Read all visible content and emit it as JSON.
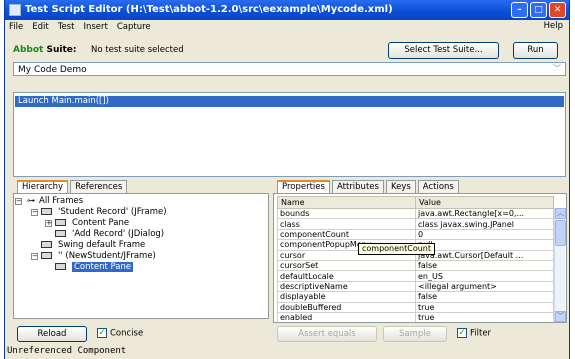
{
  "window": {
    "title": "Test Script Editor  (H:\\Test\\abbot-1.2.0\\src\\eexample\\Mycode.xml)",
    "minimize": "–",
    "maximize": "□",
    "close": "✕"
  },
  "menu": {
    "items": [
      "File",
      "Edit",
      "Test",
      "Insert",
      "Capture"
    ],
    "help": "Help"
  },
  "suite": {
    "label_abbot": "Abbot",
    "label_rest": " Suite:",
    "status": "No test suite selected",
    "select_button": "Select Test Suite...",
    "run_button": "Run"
  },
  "script": {
    "name": "My Code Demo",
    "steps": [
      "Launch Main.main([])"
    ]
  },
  "left_tabs": [
    "Hierarchy",
    "References"
  ],
  "tree": [
    {
      "label": "All Frames"
    },
    {
      "label": "'Student Record' (JFrame)"
    },
    {
      "label": "Content Pane"
    },
    {
      "label": "'Add Record' (JDialog)"
    },
    {
      "label": "Swing default Frame"
    },
    {
      "label": "'' (NewStudent/JFrame)"
    },
    {
      "label": "Content Pane"
    }
  ],
  "left_buttons": {
    "reload": "Reload",
    "concise": "Concise",
    "concise_checked": "✓"
  },
  "right_tabs": [
    "Properties",
    "Attributes",
    "Keys",
    "Actions"
  ],
  "properties": {
    "columns": [
      "Name",
      "Value"
    ],
    "rows": [
      [
        "bounds",
        "java.awt.Rectangle[x=0,..."
      ],
      [
        "class",
        "class javax.swing.JPanel"
      ],
      [
        "componentCount",
        "0"
      ],
      [
        "componentPopupMenu",
        "null"
      ],
      [
        "cursor",
        "java.awt.Cursor[Default ..."
      ],
      [
        "cursorSet",
        "false"
      ],
      [
        "defaultLocale",
        "en_US"
      ],
      [
        "descriptiveName",
        "<illegal argument>"
      ],
      [
        "displayable",
        "false"
      ],
      [
        "doubleBuffered",
        "true"
      ],
      [
        "enabled",
        "true"
      ]
    ],
    "tooltip": "componentCount"
  },
  "right_buttons": {
    "assert": "Assert equals",
    "sample": "Sample",
    "filter": "Filter",
    "filter_checked": "✓"
  },
  "status_bar": "Unreferenced Component",
  "colors": {
    "title_blue": "#0b50d8",
    "selection": "#316ac5",
    "tab_accent": "#e68b2c"
  }
}
